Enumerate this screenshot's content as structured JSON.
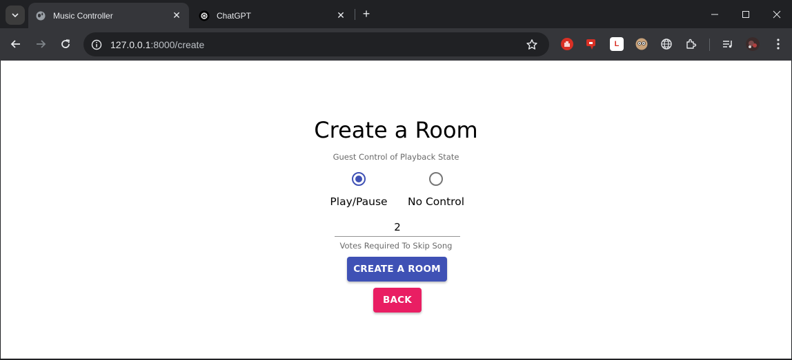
{
  "browser": {
    "tabs": [
      {
        "title": "Music Controller",
        "active": true
      },
      {
        "title": "ChatGPT",
        "active": false
      }
    ],
    "url_host": "127.0.0.1",
    "url_path": ":8000/create"
  },
  "page": {
    "title": "Create a Room",
    "playback_helper": "Guest Control of Playback State",
    "radio_options": [
      {
        "label": "Play/Pause",
        "checked": true
      },
      {
        "label": "No Control",
        "checked": false
      }
    ],
    "votes_value": "2",
    "votes_helper": "Votes Required To Skip Song",
    "create_button": "CREATE A ROOM",
    "back_button": "BACK"
  },
  "colors": {
    "primary": "#3f51b5",
    "secondary": "#e91e63"
  }
}
